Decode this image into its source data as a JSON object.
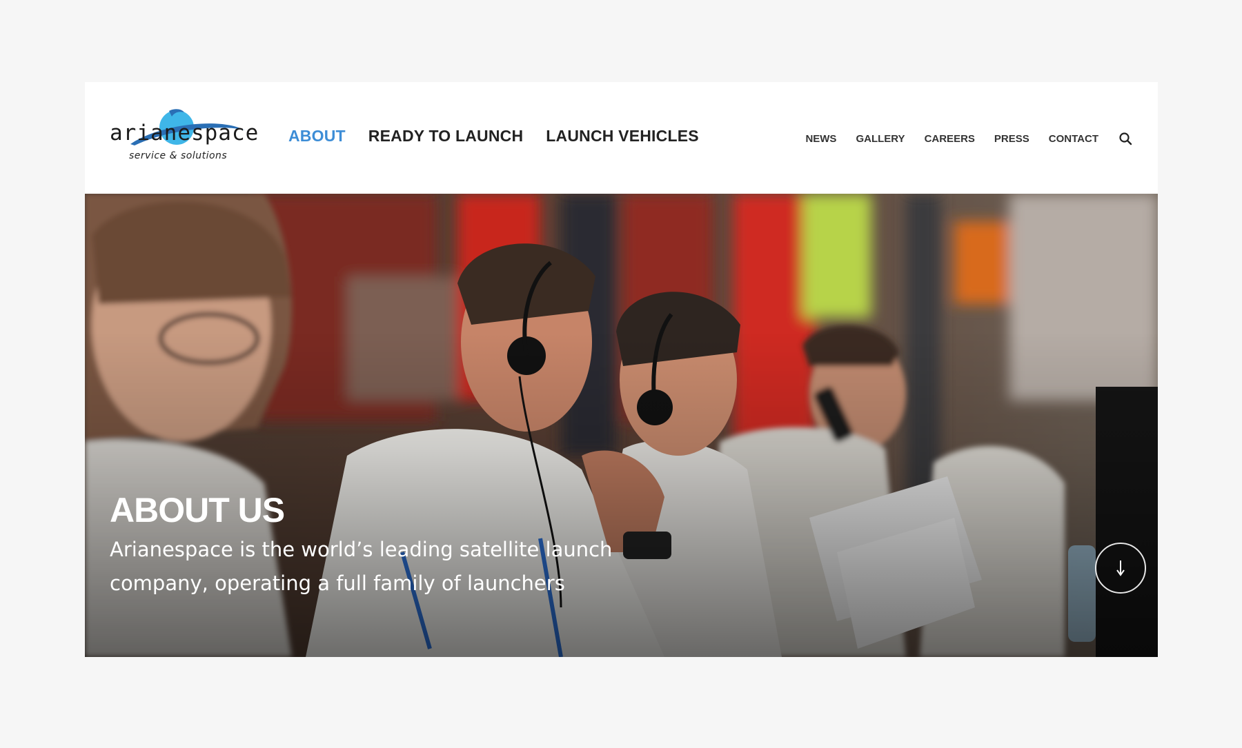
{
  "logo": {
    "wordmark": "arianespace",
    "tagline": "service & solutions",
    "accent_color": "#3fb6e8"
  },
  "main_nav": {
    "items": [
      {
        "label": "ABOUT",
        "active": true
      },
      {
        "label": "READY TO LAUNCH",
        "active": false
      },
      {
        "label": "LAUNCH VEHICLES",
        "active": false
      }
    ],
    "active_color": "#3d8dd6"
  },
  "util_nav": {
    "items": [
      {
        "label": "NEWS"
      },
      {
        "label": "GALLERY"
      },
      {
        "label": "CAREERS"
      },
      {
        "label": "PRESS"
      },
      {
        "label": "CONTACT"
      }
    ],
    "search_icon": "search-icon"
  },
  "hero": {
    "title": "ABOUT US",
    "subtitle": "Arianespace is the world’s leading satellite launch company, operating a full family of launchers",
    "scroll_icon": "arrow-down-icon"
  }
}
